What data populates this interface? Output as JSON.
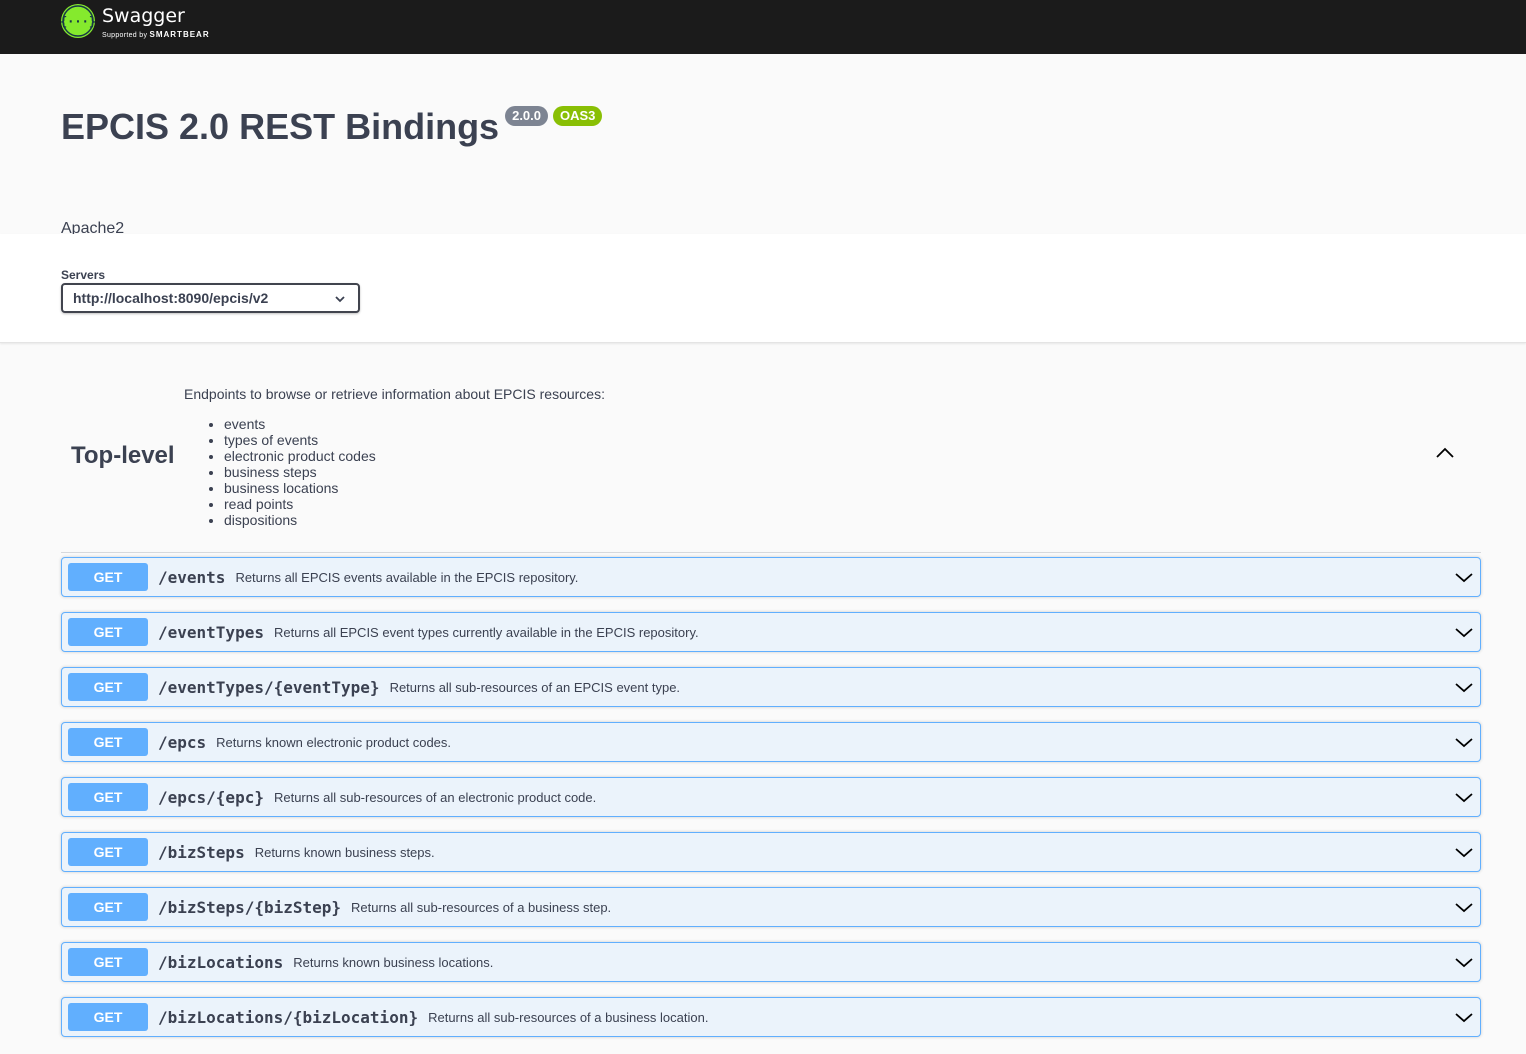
{
  "topbar": {
    "brand_name": "Swagger",
    "brand_sub_prefix": "Supported by",
    "brand_sub_company": "SMARTBEAR",
    "logo_icon": "swagger-braces-icon"
  },
  "info": {
    "title": "EPCIS 2.0 REST Bindings",
    "version": "2.0.0",
    "oas_badge": "OAS3",
    "license": "Apache2"
  },
  "servers": {
    "label": "Servers",
    "selected": "http://localhost:8090/epcis/v2"
  },
  "tag": {
    "name": "Top-level",
    "description": "Endpoints to browse or retrieve information about EPCIS resources:",
    "items": [
      "events",
      "types of events",
      "electronic product codes",
      "business steps",
      "business locations",
      "read points",
      "dispositions"
    ]
  },
  "operations": [
    {
      "method": "GET",
      "path": "/events",
      "summary": "Returns all EPCIS events available in the EPCIS repository."
    },
    {
      "method": "GET",
      "path": "/eventTypes",
      "summary": "Returns all EPCIS event types currently available in the EPCIS repository."
    },
    {
      "method": "GET",
      "path": "/eventTypes/{eventType}",
      "summary": "Returns all sub-resources of an EPCIS event type."
    },
    {
      "method": "GET",
      "path": "/epcs",
      "summary": "Returns known electronic product codes."
    },
    {
      "method": "GET",
      "path": "/epcs/{epc}",
      "summary": "Returns all sub-resources of an electronic product code."
    },
    {
      "method": "GET",
      "path": "/bizSteps",
      "summary": "Returns known business steps."
    },
    {
      "method": "GET",
      "path": "/bizSteps/{bizStep}",
      "summary": "Returns all sub-resources of a business step."
    },
    {
      "method": "GET",
      "path": "/bizLocations",
      "summary": "Returns known business locations."
    },
    {
      "method": "GET",
      "path": "/bizLocations/{bizLocation}",
      "summary": "Returns all sub-resources of a business location."
    }
  ],
  "colors": {
    "get_accent": "#61affe",
    "get_bg": "#ebf3fb",
    "topbar_bg": "#1b1b1b",
    "logo_green": "#85ea2d",
    "oas_badge": "#89bf04",
    "version_badge": "#7d8492"
  }
}
